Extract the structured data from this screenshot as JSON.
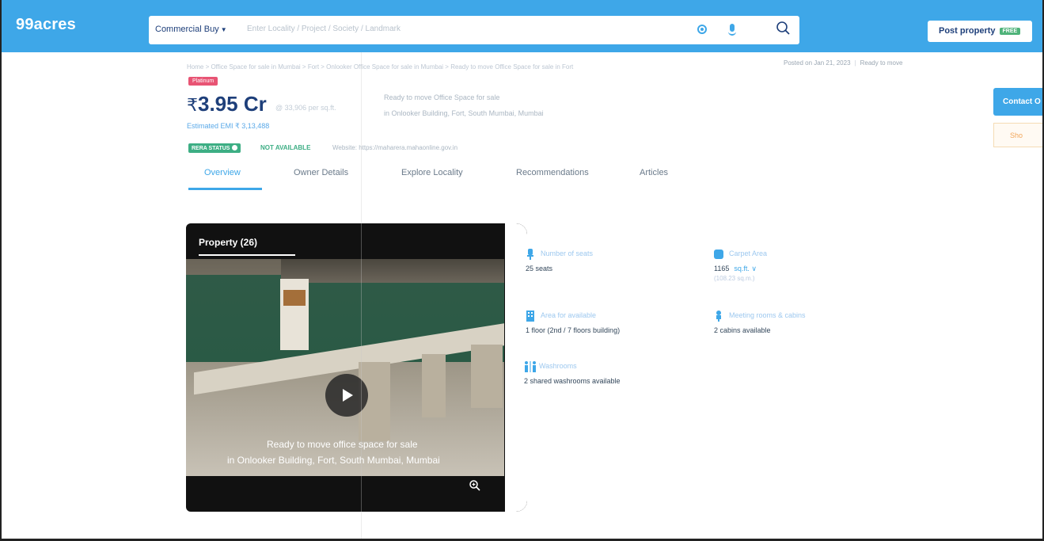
{
  "header": {
    "logo": "99acres",
    "search": {
      "type_label": "Commercial Buy",
      "placeholder": "Enter Locality / Project / Society / Landmark"
    },
    "post_property": {
      "label": "Post property",
      "badge": "FREE"
    }
  },
  "meta": {
    "breadcrumb": "Home > Office Space for sale in Mumbai > Fort > Onlooker Office Space for sale in Mumbai > Ready to move Office Space for sale in Fort",
    "posted_on": "Posted on Jan 21, 2023",
    "status": "Ready to move"
  },
  "listing": {
    "tier_badge": "Platinum",
    "price_symbol": "₹",
    "price": "3.95 Cr",
    "price_per_unit": "@ 33,906 per sq.ft.",
    "emi": "Estimated EMI ₹ 3,13,488",
    "title_line1": "Ready to move Office Space for sale",
    "title_line2": "in Onlooker Building, Fort, South Mumbai, Mumbai",
    "rera_label": "RERA STATUS",
    "rera_status": "NOT AVAILABLE",
    "rera_url": "Website: https://maharera.mahaonline.gov.in"
  },
  "tabs": [
    {
      "label": "Overview"
    },
    {
      "label": "Owner Details"
    },
    {
      "label": "Explore Locality"
    },
    {
      "label": "Recommendations"
    },
    {
      "label": "Articles"
    }
  ],
  "media": {
    "title": "Property (26)",
    "caption_line1": "Ready to move office space for sale",
    "caption_line2": "in Onlooker Building, Fort, South Mumbai, Mumbai"
  },
  "specs": {
    "seats": {
      "label": "Number of seats",
      "value": "25 seats",
      "icon": "seat-icon"
    },
    "carpet": {
      "label": "Carpet Area",
      "value": "1165",
      "unit": "sq.ft. ∨",
      "sub": "(108.23 sq.m.)",
      "icon": "area-icon"
    },
    "floor": {
      "label": "Area for available",
      "value": "1 floor (2nd / 7 floors building)",
      "icon": "building-icon"
    },
    "meeting": {
      "label": "Meeting rooms & cabins",
      "value": "2 cabins available",
      "icon": "cabin-icon"
    },
    "washrooms": {
      "label": "Washrooms",
      "value": "2 shared washrooms available",
      "icon": "washroom-icon"
    }
  },
  "side": {
    "contact": "Contact O",
    "shortlist": "Sho"
  },
  "colors": {
    "brand_blue": "#3ea7e8",
    "navy": "#1e3f7a",
    "rera_green": "#3dae84",
    "platinum_pink": "#e85474"
  }
}
